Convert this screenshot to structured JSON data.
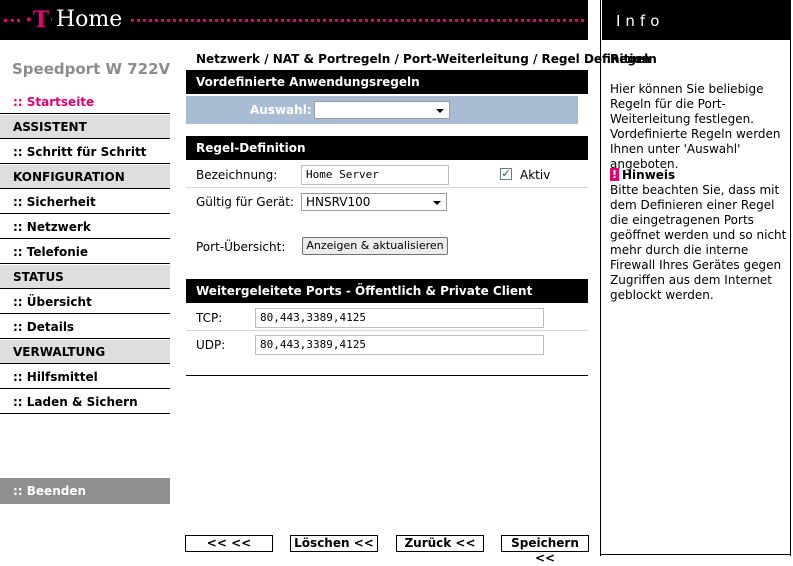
{
  "header": {
    "logo_t": "·T·",
    "logo_home": "Home",
    "info_title": "Info"
  },
  "sidebar": {
    "product": "Speedport W 722V",
    "items": [
      {
        "label": ":: Startseite",
        "type": "link",
        "active": true
      },
      {
        "label": "ASSISTENT",
        "type": "section"
      },
      {
        "label": ":: Schritt für Schritt",
        "type": "link"
      },
      {
        "label": "KONFIGURATION",
        "type": "section"
      },
      {
        "label": ":: Sicherheit",
        "type": "link"
      },
      {
        "label": ":: Netzwerk",
        "type": "link"
      },
      {
        "label": ":: Telefonie",
        "type": "link"
      },
      {
        "label": "STATUS",
        "type": "section"
      },
      {
        "label": ":: Übersicht",
        "type": "link"
      },
      {
        "label": ":: Details",
        "type": "link"
      },
      {
        "label": "VERWALTUNG",
        "type": "section"
      },
      {
        "label": ":: Hilfsmittel",
        "type": "link"
      },
      {
        "label": ":: Laden & Sichern",
        "type": "link"
      }
    ],
    "logout": ":: Beenden"
  },
  "main": {
    "breadcrumb": "Netzwerk / NAT & Portregeln / Port-Weiterleitung / Regel Definition",
    "predefined": {
      "title": "Vordefinierte Anwendungsregeln",
      "select_label": "Auswahl:",
      "select_value": ""
    },
    "rule": {
      "title": "Regel-Definition",
      "name_label": "Bezeichnung:",
      "name_value": "Home Server",
      "active_label": "Aktiv",
      "active_checked": true,
      "device_label": "Gültig für Gerät:",
      "device_value": "HNSRV100",
      "ports_label": "Port-Übersicht:",
      "ports_button": "Anzeigen & aktualisieren"
    },
    "forwarded": {
      "title": "Weitergeleitete Ports - Öffentlich & Private Client",
      "tcp_label": "TCP:",
      "tcp_value": "80,443,3389,4125",
      "udp_label": "UDP:",
      "udp_value": "80,443,3389,4125"
    },
    "footer": {
      "back_all": "<<  <<",
      "delete": "Löschen <<",
      "back": "Zurück <<",
      "save": "Speichern <<"
    }
  },
  "info": {
    "heading": "Regeln",
    "text": "Hier können Sie beliebige Regeln für die Port-Weiterleitung festlegen. Vordefinierte Regeln werden Ihnen unter 'Auswahl' angeboten.",
    "hint_icon": "!",
    "hint_title": "Hinweis",
    "hint_text": "Bitte beachten Sie, dass mit dem Definieren einer Regel die eingetragenen Ports geöffnet werden und so nicht mehr durch die interne Firewall Ihres Gerätes gegen Zugriffen aus dem Internet geblockt werden."
  },
  "colors": {
    "accent": "#e20074",
    "band": "#a8bdd4",
    "sidebar_section": "#dedede"
  }
}
